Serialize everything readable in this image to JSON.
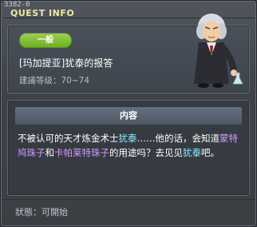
{
  "window": {
    "quest_id": "3382-0",
    "title": "QUEST INFO"
  },
  "quest": {
    "category": "一般",
    "name": "[玛加提亚]犹泰的报答",
    "level_range": "建議等级：70~74"
  },
  "description": {
    "header": "内容",
    "segments": {
      "s1": "不被认可的天才炼金术士",
      "s2": "犹泰",
      "s3": "……他的话，会知道",
      "s4": "蒙特鸠珠子",
      "s5": "和",
      "s6": "卡帕莱特珠子",
      "s7": "的用途吗？去见见",
      "s8": "犹泰",
      "s9": "吧。"
    }
  },
  "status": {
    "text": "狀態：可開始"
  },
  "colors": {
    "badge": "#7dbd34",
    "npc_highlight": "#8de8ff",
    "item_highlight": "#d199ff",
    "title": "#f2e7a8"
  }
}
